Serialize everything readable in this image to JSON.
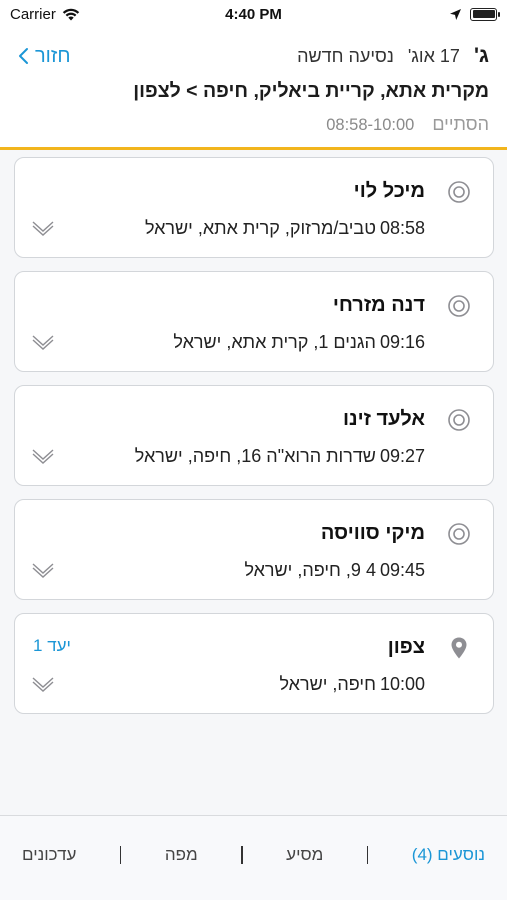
{
  "status_bar": {
    "carrier": "Carrier",
    "time": "4:40 PM"
  },
  "header": {
    "day_letter": "ג'",
    "date": "17 אוג'",
    "trip_label": "נסיעה חדשה",
    "back_label": "חזור",
    "route_title": "מקרית אתא, קריית ביאליק, חיפה > לצפון",
    "time_range": "08:58-10:00",
    "status": "הסתיים"
  },
  "stops": [
    {
      "name": "מיכל לוי",
      "time": "08:58",
      "address": "טביב/מרזוק, קרית אתא, ישראל",
      "icon": "target-icon"
    },
    {
      "name": "דנה מזרחי",
      "time": "09:16",
      "address": "הגנים 1, קרית אתא, ישראל",
      "icon": "target-icon"
    },
    {
      "name": "אלעד זינו",
      "time": "09:27",
      "address": "שדרות הרוא\"ה 16, חיפה, ישראל",
      "icon": "target-icon"
    },
    {
      "name": "מיקי סוויסה",
      "time": "09:45",
      "address": "4 9, חיפה, ישראל",
      "icon": "target-icon"
    },
    {
      "name": "צפון",
      "time": "10:00",
      "address": "חיפה, ישראל",
      "icon": "map-pin-icon",
      "badge": "יעד 1"
    }
  ],
  "tabs": [
    {
      "label": "נוסעים (4)",
      "active": true
    },
    {
      "label": "מסיע",
      "active": false
    },
    {
      "label": "מפה",
      "active": false
    },
    {
      "label": "עדכונים",
      "active": false
    }
  ],
  "colors": {
    "accent": "#1b96d6",
    "header_rule": "#f2b51c",
    "card_border": "#d3d6da",
    "icon_gray": "#8e8e93"
  }
}
